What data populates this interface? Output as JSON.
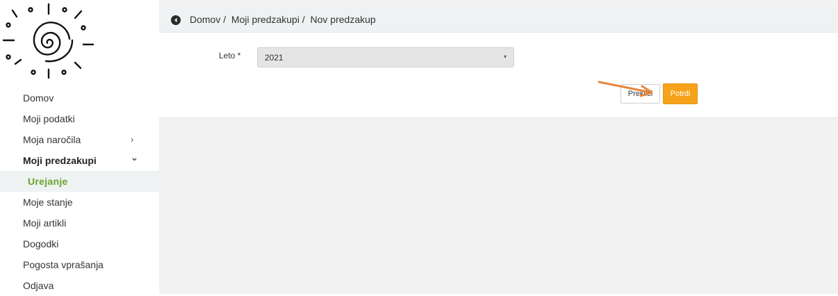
{
  "sidebar": {
    "items": [
      {
        "label": "Domov"
      },
      {
        "label": "Moji podatki"
      },
      {
        "label": "Moja naročila",
        "chevron": "chevron-right-icon"
      },
      {
        "label": "Moji predzakupi",
        "chevron": "chevron-down-icon"
      },
      {
        "label": "Urejanje"
      },
      {
        "label": "Moje stanje"
      },
      {
        "label": "Moji artikli"
      },
      {
        "label": "Dogodki"
      },
      {
        "label": "Pogosta vprašanja"
      },
      {
        "label": "Odjava"
      }
    ],
    "chevron_right": "›",
    "chevron_down": "⌄"
  },
  "breadcrumb": {
    "icon": "back-circle-icon",
    "text": "Domov /  Moji predzakupi /  Nov predzakup"
  },
  "form": {
    "year_label": "Leto *",
    "year_value": "2021",
    "caret": "▾",
    "cancel_label": "Prekliči",
    "confirm_label": "Potrdi"
  },
  "colors": {
    "accent": "#f7a21b",
    "active_sub": "#6aa32a",
    "annotation_arrow": "#e8843a"
  }
}
